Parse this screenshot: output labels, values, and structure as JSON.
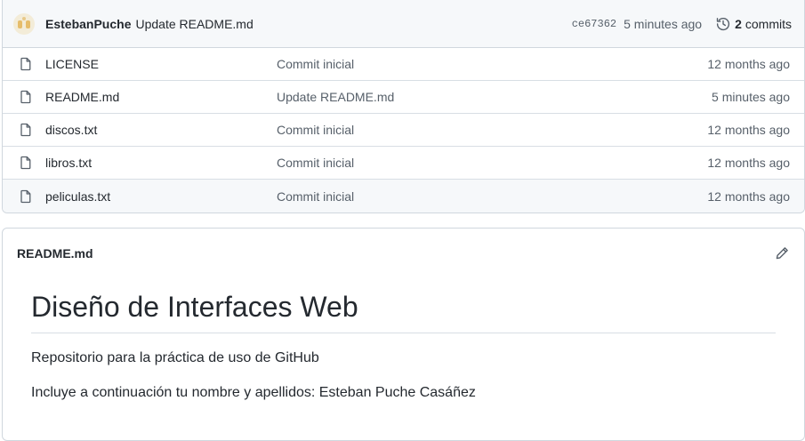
{
  "commit": {
    "author": "EstebanPuche",
    "message": "Update README.md",
    "sha": "ce67362",
    "time": "5 minutes ago",
    "count": "2",
    "count_label": "commits"
  },
  "files": [
    {
      "name": "LICENSE",
      "commit": "Commit inicial",
      "time": "12 months ago"
    },
    {
      "name": "README.md",
      "commit": "Update README.md",
      "time": "5 minutes ago"
    },
    {
      "name": "discos.txt",
      "commit": "Commit inicial",
      "time": "12 months ago"
    },
    {
      "name": "libros.txt",
      "commit": "Commit inicial",
      "time": "12 months ago"
    },
    {
      "name": "peliculas.txt",
      "commit": "Commit inicial",
      "time": "12 months ago"
    }
  ],
  "readme": {
    "filename": "README.md",
    "heading": "Diseño de Interfaces Web",
    "paragraphs": [
      "Repositorio para la práctica de uso de GitHub",
      "Incluye a continuación tu nombre y apellidos: Esteban Puche Casáñez"
    ]
  },
  "icons": {
    "file": "file-icon",
    "history": "history-icon",
    "edit": "pencil-icon"
  }
}
